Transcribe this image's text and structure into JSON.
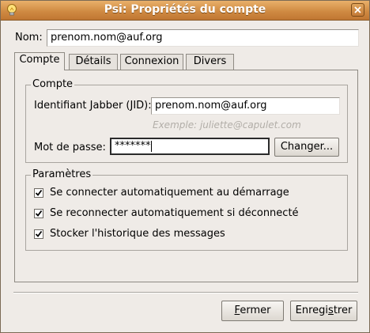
{
  "window": {
    "title": "Psi: Propriétés du compte"
  },
  "name": {
    "label": "Nom:",
    "value": "prenom.nom@auf.org"
  },
  "tabs": [
    {
      "label": "Compte",
      "active": true
    },
    {
      "label": "Détails",
      "active": false
    },
    {
      "label": "Connexion",
      "active": false
    },
    {
      "label": "Divers",
      "active": false
    }
  ],
  "compte": {
    "title": "Compte",
    "jid_label": "Identifiant Jabber (JID):",
    "jid_value": "prenom.nom@auf.org",
    "jid_example": "Exemple: juliette@capulet.com",
    "password_label": "Mot de passe:",
    "password_value": "*******",
    "change_button": "Changer..."
  },
  "parametres": {
    "title": "Paramètres",
    "options": [
      {
        "label": "Se connecter automatiquement au démarrage",
        "checked": true
      },
      {
        "label": "Se reconnecter automatiquement si déconnecté",
        "checked": true
      },
      {
        "label": "Stocker l'historique des messages",
        "checked": true
      }
    ]
  },
  "footer": {
    "close_button": {
      "mnemonic": "F",
      "rest": "ermer"
    },
    "save_button": {
      "pre": "Enregi",
      "mnemonic": "s",
      "rest": "trer"
    }
  },
  "icons": {
    "app": "lightbulb-icon",
    "close": "close-icon",
    "check": "checkmark-icon"
  }
}
